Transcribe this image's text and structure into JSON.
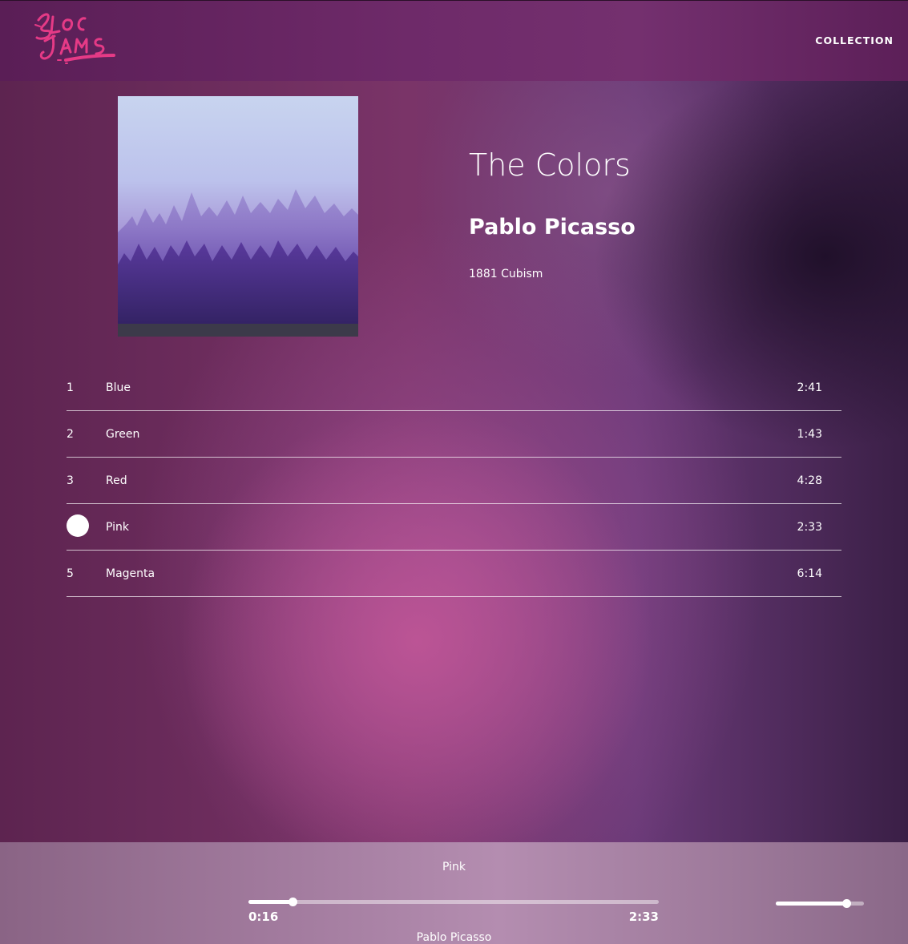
{
  "navbar": {
    "logo_text": "Bloc Jams",
    "collection_link": "COLLECTION"
  },
  "album": {
    "title": "The Colors",
    "artist": "Pablo Picasso",
    "release_info": "1881 Cubism",
    "cover_icon": "forest-album-cover"
  },
  "songs": [
    {
      "number": "1",
      "title": "Blue",
      "duration": "2:41"
    },
    {
      "number": "2",
      "title": "Green",
      "duration": "1:43"
    },
    {
      "number": "3",
      "title": "Red",
      "duration": "4:28"
    },
    {
      "number": "",
      "title": "Pink",
      "duration": "2:33",
      "playing": true
    },
    {
      "number": "5",
      "title": "Magenta",
      "duration": "6:14"
    }
  ],
  "player": {
    "song": "Pink",
    "artist": "Pablo Picasso",
    "current_time": "0:16",
    "total_time": "2:33",
    "seek_progress": 0.107,
    "volume_level": 0.8
  },
  "colors": {
    "logo": "#e53a86",
    "navbar": "#6e2a69",
    "player_bar": "#b48db0"
  }
}
